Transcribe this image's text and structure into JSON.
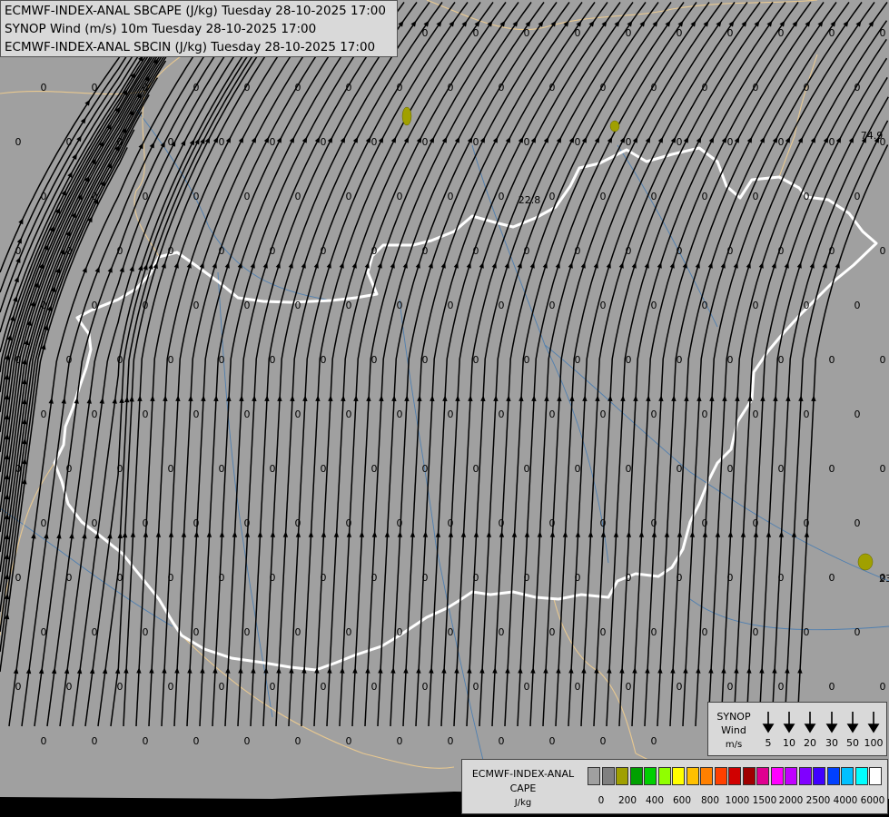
{
  "titles": [
    "ECMWF-INDEX-ANAL SBCAPE (J/kg) Tuesday 28-10-2025 17:00",
    "SYNOP Wind (m/s) 10m Tuesday 28-10-2025 17:00",
    "ECMWF-INDEX-ANAL SBCIN (J/kg) Tuesday 28-10-2025 17:00"
  ],
  "map_labels": {
    "zero": "0",
    "value_a": "74.9",
    "value_b": "22.8",
    "value_c": "23"
  },
  "synop_legend": {
    "title_line1": "SYNOP",
    "title_line2": "Wind",
    "unit": "m/s",
    "speeds": [
      "5",
      "10",
      "20",
      "30",
      "50",
      "100"
    ]
  },
  "cape_legend": {
    "title_line1": "ECMWF-INDEX-ANAL",
    "title_line2": "CAPE",
    "unit": "J/kg",
    "ticks": [
      "0",
      "200",
      "400",
      "600",
      "800",
      "1000",
      "1500",
      "2000",
      "2500",
      "4000",
      "6000"
    ],
    "colors": [
      "#a0a0a0",
      "#808080",
      "#a0a000",
      "#00a000",
      "#00d000",
      "#90ff00",
      "#ffff00",
      "#ffc000",
      "#ff8000",
      "#ff4000",
      "#d00000",
      "#a00000",
      "#e00090",
      "#ff00ff",
      "#c000ff",
      "#8000ff",
      "#4000ff",
      "#0040ff",
      "#00c0ff",
      "#00ffff",
      "#ffffff"
    ]
  },
  "colors": {
    "background": "#a0a0a0",
    "national_border": "#ffffff",
    "country_borders": "#e8c890",
    "rivers": "#4f7fb0",
    "streamlines": "#000000",
    "cape_patch": "#a0a000"
  }
}
